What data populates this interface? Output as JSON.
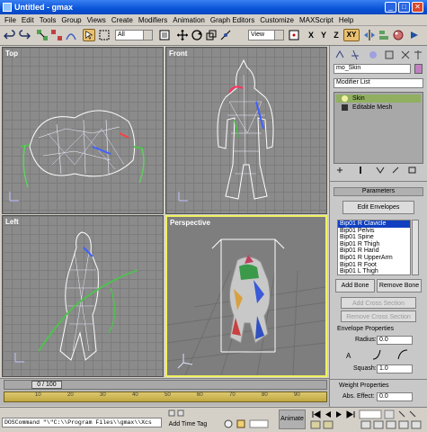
{
  "window": {
    "title": "Untitled - gmax",
    "minimize": "_",
    "maximize": "□",
    "close": "✕"
  },
  "menu": [
    "File",
    "Edit",
    "Tools",
    "Group",
    "Views",
    "Create",
    "Modifiers",
    "Animation",
    "Graph Editors",
    "Customize",
    "MAXScript",
    "Help"
  ],
  "toolbar": {
    "selection_filter": "All",
    "ref_coord": "View",
    "axis_labels": [
      "X",
      "Y",
      "Z",
      "XY"
    ]
  },
  "viewports": {
    "top": "Top",
    "front": "Front",
    "left": "Left",
    "perspective": "Perspective"
  },
  "command_panel": {
    "object_name": "mo_Skin",
    "modifier_list": "Modifier List",
    "stack": [
      "Skin",
      "Editable Mesh"
    ],
    "parameters_header": "Parameters",
    "edit_envelopes": "Edit Envelopes",
    "bones": [
      "Bip01 R Clavicle",
      "Bip01 Pelvis",
      "Bip01 Spine",
      "Bip01 R Thigh",
      "Bip01 R Hand",
      "Bip01 R UpperArm",
      "Bip01 R Foot",
      "Bip01 L Thigh"
    ],
    "add_bone": "Add Bone",
    "remove_bone": "Remove Bone",
    "add_cross_section": "Add Cross Section",
    "remove_cross_section": "Remove Cross Section",
    "envelope_properties": "Envelope Properties",
    "radius_label": "Radius:",
    "radius_value": "0.0",
    "squash_label": "Squash:",
    "squash_value": "1.0",
    "weight_properties": "Weight Properties",
    "abs_effect_label": "Abs. Effect:",
    "abs_effect_value": "0.0"
  },
  "timeline": {
    "frame_display": "0 / 100",
    "ticks": [
      "10",
      "20",
      "30",
      "40",
      "50",
      "60",
      "70",
      "80",
      "90"
    ]
  },
  "status": {
    "maxscript": "DOSCommand \"\\\"C:\\\\Program Files\\\\gmax\\\\Xcs",
    "add_time_tag": "Add Time Tag",
    "animate": "Animate"
  },
  "colors": {
    "title_bar": "#0a54d8",
    "viewport_bg": "#8b8b8b",
    "active_border": "#f0f060",
    "trackbar": "#c0a840",
    "list_selection": "#1040c0"
  }
}
